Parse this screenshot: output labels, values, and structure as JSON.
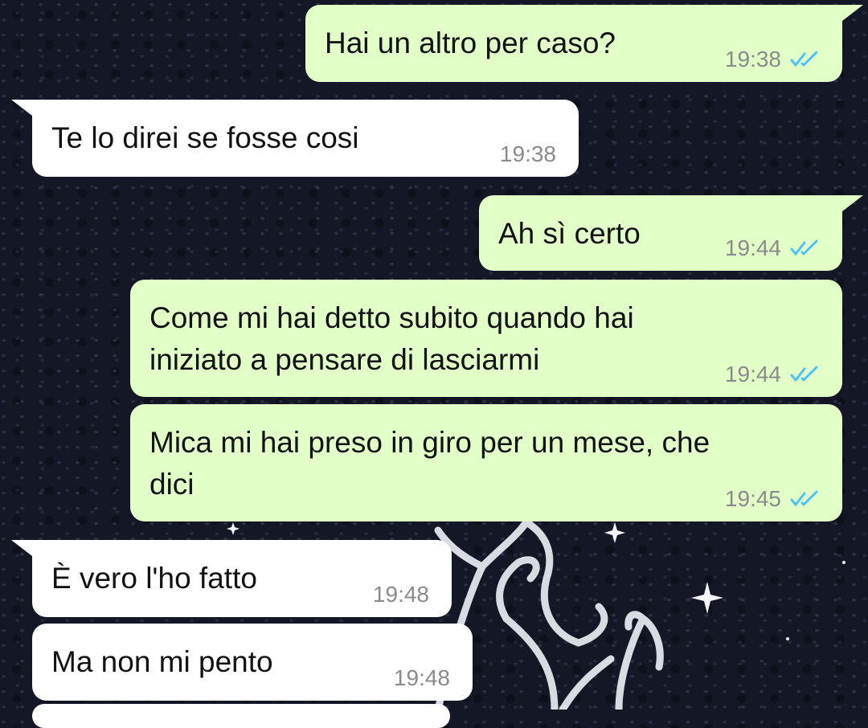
{
  "chat": {
    "messages": [
      {
        "text": "Hai un altro per caso?",
        "time": "19:38"
      },
      {
        "text": "Te lo direi se fosse cosi",
        "time": "19:38"
      },
      {
        "text": "Ah sì certo",
        "time": "19:44"
      },
      {
        "text": "Come mi hai detto subito quando hai\niniziato a pensare di lasciarmi",
        "time": "19:44"
      },
      {
        "text": "Mica mi hai preso in giro per un mese, che\ndici",
        "time": "19:45"
      },
      {
        "text": "È vero l'ho fatto",
        "time": "19:48"
      },
      {
        "text": "Ma non mi pento",
        "time": "19:48"
      }
    ]
  },
  "colors": {
    "outgoing_bubble": "#e1ffc7",
    "incoming_bubble": "#ffffff",
    "read_ticks": "#4fc3f7",
    "timestamp": "#8b8b8b",
    "wallpaper": "#141826"
  },
  "icons": {
    "read_receipt": "double-check-icon"
  }
}
